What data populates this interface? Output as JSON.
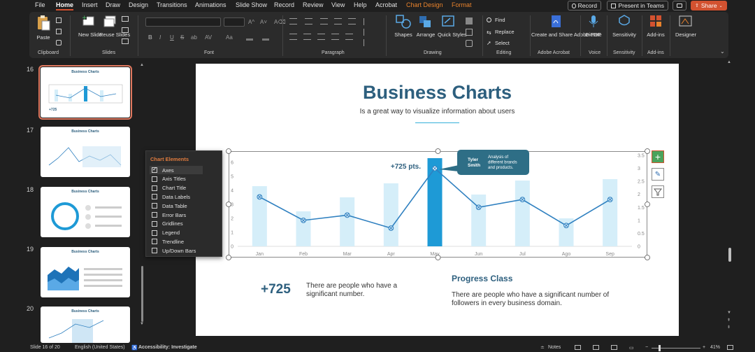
{
  "menubar": {
    "items": [
      {
        "label": "File"
      },
      {
        "label": "Home"
      },
      {
        "label": "Insert"
      },
      {
        "label": "Draw"
      },
      {
        "label": "Design"
      },
      {
        "label": "Transitions"
      },
      {
        "label": "Animations"
      },
      {
        "label": "Slide Show"
      },
      {
        "label": "Record"
      },
      {
        "label": "Review"
      },
      {
        "label": "View"
      },
      {
        "label": "Help"
      },
      {
        "label": "Acrobat"
      },
      {
        "label": "Chart Design"
      },
      {
        "label": "Format"
      }
    ],
    "record_btn": "Record",
    "present_btn": "Present in Teams",
    "share_btn": "Share"
  },
  "ribbon": {
    "clipboard": {
      "paste": "Paste",
      "label": "Clipboard"
    },
    "slides": {
      "new_slide": "New Slide",
      "reuse_slides": "Reuse Slides",
      "label": "Slides"
    },
    "font": {
      "label": "Font",
      "bold": "B",
      "italic": "I",
      "underline": "U",
      "strike": "S",
      "ab": "ab",
      "av": "AV",
      "aa": "Aa"
    },
    "paragraph": {
      "label": "Paragraph"
    },
    "drawing": {
      "shapes": "Shapes",
      "arrange": "Arrange",
      "quick_styles": "Quick Styles",
      "label": "Drawing"
    },
    "editing": {
      "find": "Find",
      "replace": "Replace",
      "select": "Select",
      "label": "Editing"
    },
    "adobe": {
      "create_share": "Create and Share Adobe PDF",
      "label": "Adobe Acrobat"
    },
    "voice": {
      "dictate": "Dictate",
      "label": "Voice"
    },
    "sensitivity": {
      "btn": "Sensitivity",
      "label": "Sensitivity"
    },
    "addins": {
      "btn": "Add-ins",
      "label": "Add-ins"
    },
    "designer": {
      "btn": "Designer"
    }
  },
  "thumbnails": [
    {
      "num": "16",
      "title": "Business Charts"
    },
    {
      "num": "17",
      "title": "Business Charts"
    },
    {
      "num": "18",
      "title": "Business Charts"
    },
    {
      "num": "19",
      "title": "Business Charts"
    },
    {
      "num": "20",
      "title": "Business Charts"
    }
  ],
  "slide": {
    "title": "Business Charts",
    "subtitle": "Is a great way to visualize information about users",
    "big_number": "+725",
    "big_text": "There are people who have a significant number.",
    "progress_title": "Progress Class",
    "progress_text": "There are people who have a significant number of followers in every business domain."
  },
  "chart_data": {
    "type": "bar",
    "categories": [
      "Jan",
      "Feb",
      "Mar",
      "Apr",
      "May",
      "Jun",
      "Jul",
      "Ago",
      "Sep"
    ],
    "series": [
      {
        "type": "bar",
        "values": [
          4.3,
          2.5,
          3.5,
          4.5,
          6.3,
          3.7,
          4.7,
          2.0,
          4.8
        ]
      },
      {
        "type": "line",
        "values": [
          1.9,
          1.0,
          1.2,
          0.7,
          3.0,
          1.5,
          1.8,
          0.8,
          1.8
        ]
      }
    ],
    "y_left_ticks": [
      "0",
      "1",
      "2",
      "3",
      "4",
      "5",
      "6"
    ],
    "y_right_ticks": [
      "0",
      "0.5",
      "1",
      "1.5",
      "2",
      "2.5",
      "3",
      "3.5"
    ],
    "ylim_left": [
      0,
      6.5
    ],
    "ylim_right": [
      0,
      3.5
    ],
    "highlight_index": 4,
    "annotation_value": "+725 pts.",
    "callout_name": "Tyler Smith",
    "callout_text": "Analysis of different brands and products.",
    "colors": {
      "bar": "#d5eef9",
      "bar_highlight": "#1e9ad6",
      "line": "#2f80c0",
      "marker": "#2f80c0"
    }
  },
  "flyout": {
    "title": "Chart Elements",
    "items": [
      {
        "label": "Axes",
        "checked": true
      },
      {
        "label": "Axis Titles",
        "checked": false
      },
      {
        "label": "Chart Title",
        "checked": false
      },
      {
        "label": "Data Labels",
        "checked": false
      },
      {
        "label": "Data Table",
        "checked": false
      },
      {
        "label": "Error Bars",
        "checked": false
      },
      {
        "label": "Gridlines",
        "checked": false
      },
      {
        "label": "Legend",
        "checked": false
      },
      {
        "label": "Trendline",
        "checked": false
      },
      {
        "label": "Up/Down Bars",
        "checked": false
      }
    ]
  },
  "status": {
    "slide_info": "Slide 16 of 20",
    "language": "English (United States)",
    "accessibility": "Accessibility: Investigate",
    "notes": "Notes",
    "zoom": "41%"
  }
}
